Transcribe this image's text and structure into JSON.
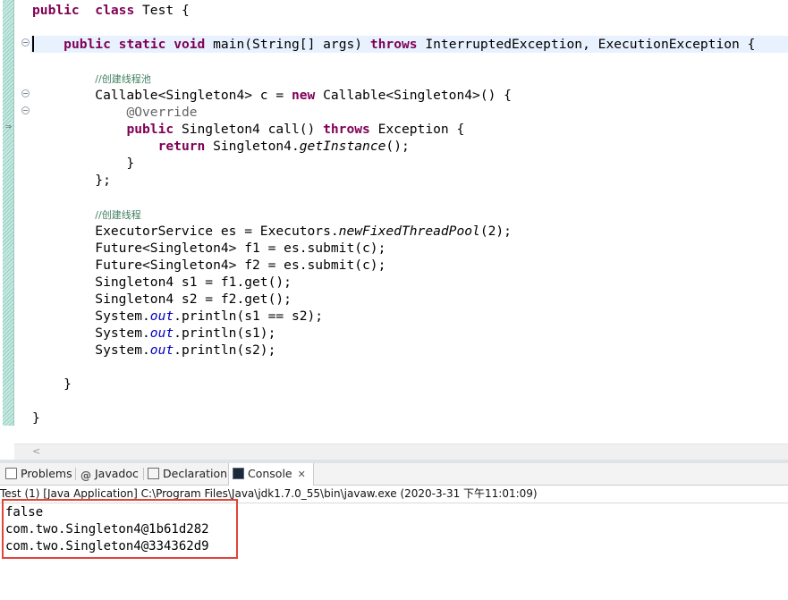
{
  "editor": {
    "code_lines": [
      {
        "parts": [
          [
            "kw",
            "public"
          ],
          [
            "",
            "  "
          ],
          [
            "kw",
            "class"
          ],
          [
            "",
            " Test {"
          ]
        ]
      },
      {
        "parts": [
          [
            "",
            ""
          ]
        ]
      },
      {
        "parts": [
          [
            "",
            "    "
          ],
          [
            "kw",
            "public"
          ],
          [
            "",
            " "
          ],
          [
            "kw",
            "static"
          ],
          [
            "",
            " "
          ],
          [
            "kw",
            "void"
          ],
          [
            "",
            " main(String[] args) "
          ],
          [
            "kw",
            "throws"
          ],
          [
            "",
            " InterruptedException, ExecutionException {"
          ]
        ],
        "highlight": true
      },
      {
        "parts": [
          [
            "",
            ""
          ]
        ]
      },
      {
        "parts": [
          [
            "",
            "        "
          ],
          [
            "cm",
            "//创建线程池"
          ]
        ]
      },
      {
        "parts": [
          [
            "",
            "        Callable<Singleton4> c = "
          ],
          [
            "kw",
            "new"
          ],
          [
            "",
            " Callable<Singleton4>() {"
          ]
        ]
      },
      {
        "parts": [
          [
            "",
            "            "
          ],
          [
            "an",
            "@Override"
          ]
        ]
      },
      {
        "parts": [
          [
            "",
            "            "
          ],
          [
            "kw",
            "public"
          ],
          [
            "",
            " Singleton4 call() "
          ],
          [
            "kw",
            "throws"
          ],
          [
            "",
            " Exception {"
          ]
        ]
      },
      {
        "parts": [
          [
            "",
            "                "
          ],
          [
            "kw",
            "return"
          ],
          [
            "",
            " Singleton4."
          ],
          [
            "it",
            "getInstance"
          ],
          [
            "",
            "();"
          ]
        ]
      },
      {
        "parts": [
          [
            "",
            "            }"
          ]
        ]
      },
      {
        "parts": [
          [
            "",
            "        };"
          ]
        ]
      },
      {
        "parts": [
          [
            "",
            ""
          ]
        ]
      },
      {
        "parts": [
          [
            "",
            "        "
          ],
          [
            "cm",
            "//创建线程"
          ]
        ]
      },
      {
        "parts": [
          [
            "",
            "        ExecutorService es = Executors."
          ],
          [
            "it",
            "newFixedThreadPool"
          ],
          [
            "",
            "(2);"
          ]
        ]
      },
      {
        "parts": [
          [
            "",
            "        Future<Singleton4> f1 = es.submit(c);"
          ]
        ]
      },
      {
        "parts": [
          [
            "",
            "        Future<Singleton4> f2 = es.submit(c);"
          ]
        ]
      },
      {
        "parts": [
          [
            "",
            "        Singleton4 s1 = f1.get();"
          ]
        ]
      },
      {
        "parts": [
          [
            "",
            "        Singleton4 s2 = f2.get();"
          ]
        ]
      },
      {
        "parts": [
          [
            "",
            "        System."
          ],
          [
            "fld",
            "out"
          ],
          [
            "",
            ".println(s1 == s2);"
          ]
        ]
      },
      {
        "parts": [
          [
            "",
            "        System."
          ],
          [
            "fld",
            "out"
          ],
          [
            "",
            ".println(s1);"
          ]
        ]
      },
      {
        "parts": [
          [
            "",
            "        System."
          ],
          [
            "fld",
            "out"
          ],
          [
            "",
            ".println(s2);"
          ]
        ]
      },
      {
        "parts": [
          [
            "",
            ""
          ]
        ]
      },
      {
        "parts": [
          [
            "",
            "    }"
          ]
        ]
      },
      {
        "parts": [
          [
            "",
            ""
          ]
        ]
      },
      {
        "parts": [
          [
            "",
            "}"
          ]
        ]
      }
    ],
    "scroll_left_glyph": "<"
  },
  "views": {
    "tabs": [
      {
        "label": "Problems",
        "icon": "problems-icon"
      },
      {
        "label": "Javadoc",
        "icon": "javadoc-icon",
        "icon_text": "@"
      },
      {
        "label": "Declaration",
        "icon": "declaration-icon"
      },
      {
        "label": "Console",
        "icon": "console-icon",
        "active": true,
        "close": "✕"
      }
    ]
  },
  "console": {
    "launch_info": "Test (1) [Java Application] C:\\Program Files\\Java\\jdk1.7.0_55\\bin\\javaw.exe (2020-3-31 下午11:01:09)",
    "output_lines": [
      "false",
      "com.two.Singleton4@1b61d282",
      "com.two.Singleton4@334362d9"
    ]
  },
  "colors": {
    "keyword": "#7f0055",
    "comment": "#3f7f5f",
    "field": "#0000c0",
    "annotation": "#646464",
    "highlight_box": "#e0453a"
  }
}
